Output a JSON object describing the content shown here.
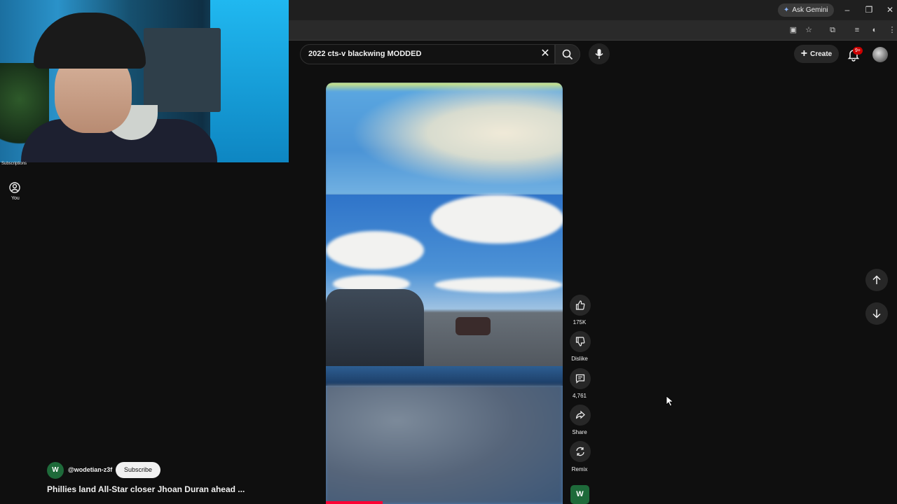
{
  "browser": {
    "ask_gemini": "Ask Gemini",
    "window_controls": [
      "minimize-icon",
      "restore-icon",
      "close-icon"
    ]
  },
  "webcam": {
    "description_icon": "webcam-overlay"
  },
  "sidebar": {
    "subscriptions_label": "Subscriptions",
    "you_label": "You"
  },
  "search": {
    "query": "2022 cts-v blackwing MODDED"
  },
  "header": {
    "create_label": "Create",
    "notifications_badge": "9+"
  },
  "actions": {
    "likes": "175K",
    "dislike_label": "Dislike",
    "comments": "4,761",
    "share_label": "Share",
    "remix_label": "Remix",
    "channel_initial": "W"
  },
  "short": {
    "channel_initial": "W",
    "channel_handle": "@wodetian-z3f",
    "subscribe_label": "Subscribe",
    "title": "Phillies land All-Star closer Jhoan Duran ahead ...",
    "progress_fraction": 0.24
  },
  "colors": {
    "background": "#0f0f0f",
    "accent": "#ff0033",
    "subscribe_bg": "#f1f1f1"
  }
}
